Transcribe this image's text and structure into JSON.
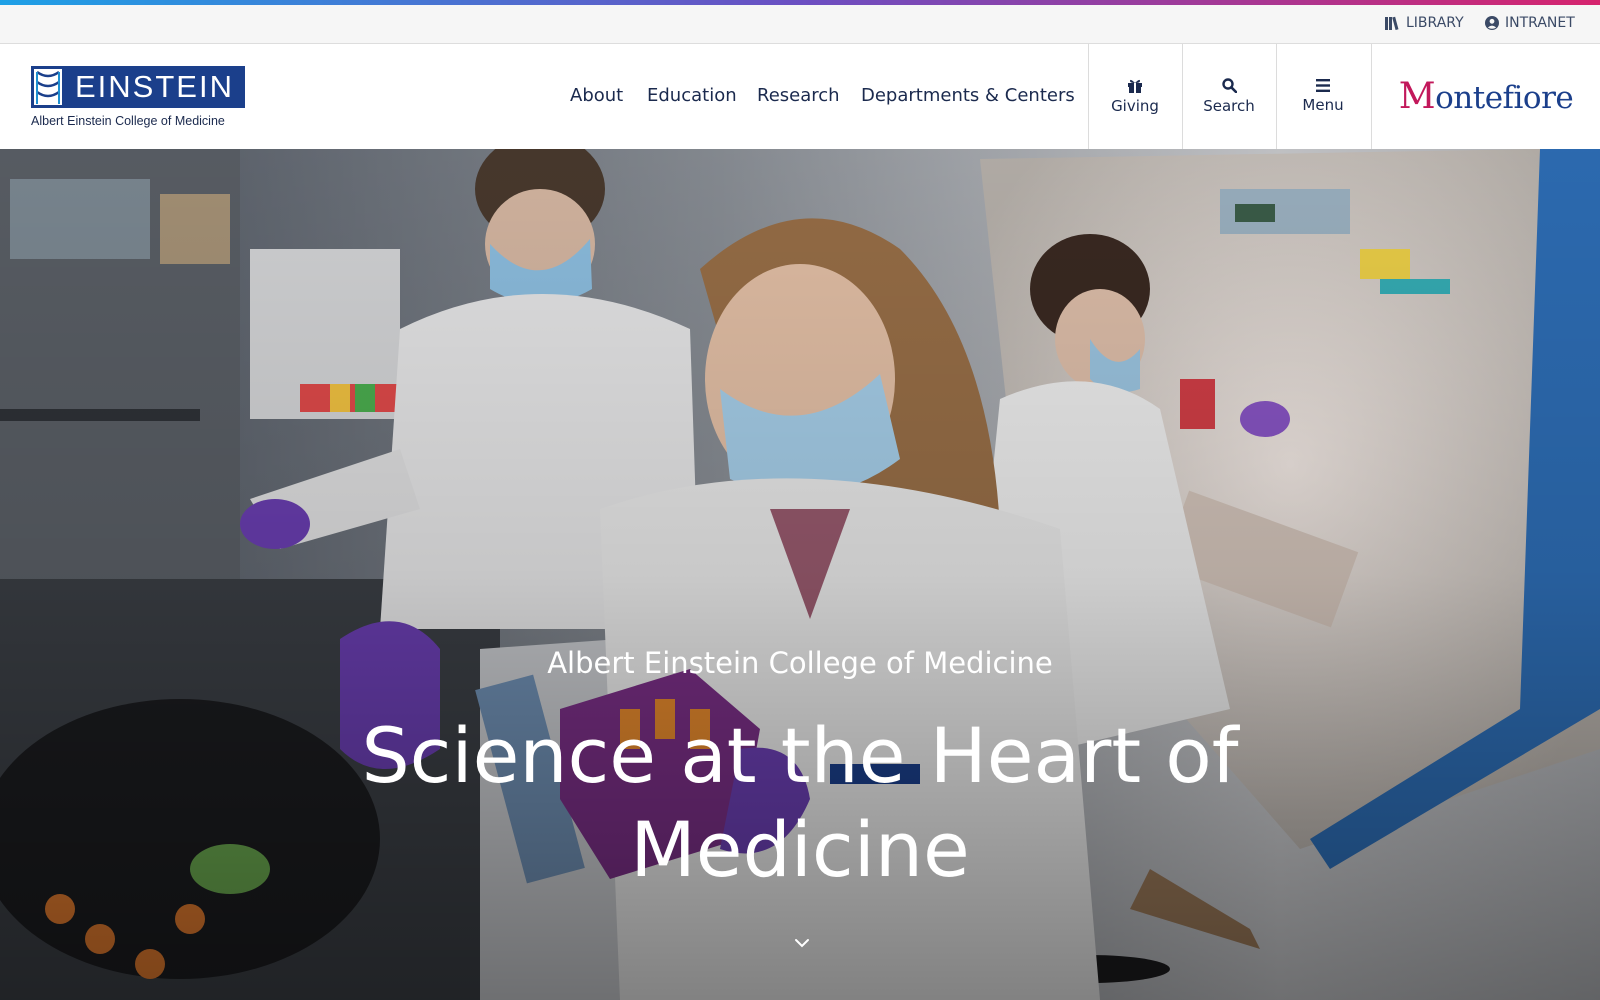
{
  "utility_bar": {
    "links": [
      {
        "label": "LIBRARY",
        "icon": "books-icon"
      },
      {
        "label": "INTRANET",
        "icon": "user-circle-icon"
      }
    ]
  },
  "header": {
    "logo": {
      "word": "EINSTEIN",
      "subtitle": "Albert Einstein College of Medicine"
    },
    "nav": [
      "About",
      "Education",
      "Research",
      "Departments & Centers"
    ],
    "buttons": [
      {
        "label": "Giving",
        "icon": "gift-icon"
      },
      {
        "label": "Search",
        "icon": "search-icon"
      },
      {
        "label": "Menu",
        "icon": "hamburger-icon"
      }
    ],
    "partner": "Montefiore"
  },
  "hero": {
    "kicker": "Albert Einstein College of Medicine",
    "title": "Science at the Heart of Medicine",
    "scroll_icon": "chevron-down-icon"
  },
  "colors": {
    "brand_navy": "#1b3f8b",
    "text_navy": "#1b2a4e",
    "partner_magenta": "#c2185b"
  }
}
